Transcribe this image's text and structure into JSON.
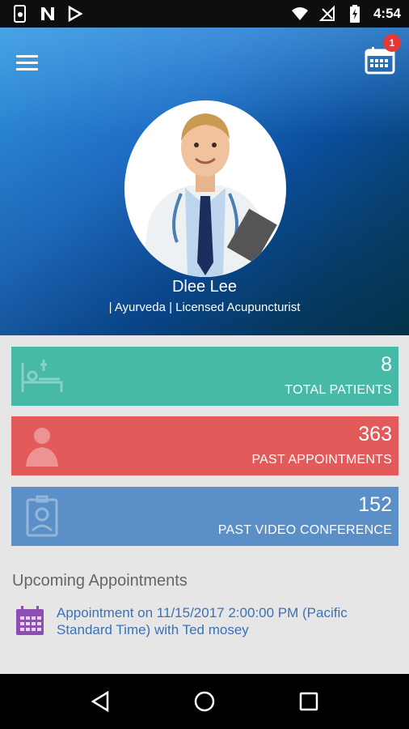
{
  "status_bar": {
    "time": "4:54",
    "left_icons": [
      "phone-settings-icon",
      "n-app-icon",
      "play-store-icon"
    ],
    "right_icons": [
      "wifi-icon",
      "no-signal-icon",
      "battery-charging-icon"
    ]
  },
  "header": {
    "menu_icon": "hamburger-icon",
    "calendar_icon": "calendar-icon",
    "notification_count": "1"
  },
  "profile": {
    "name": "Dlee Lee",
    "specialties": "| Ayurveda | Licensed Acupuncturist"
  },
  "stats": [
    {
      "value": "8",
      "label": "TOTAL PATIENTS",
      "icon": "patient-bed-icon",
      "color": "#47b9a7"
    },
    {
      "value": "363",
      "label": "PAST APPOINTMENTS",
      "icon": "doctor-icon",
      "color": "#e35a5a"
    },
    {
      "value": "152",
      "label": "PAST VIDEO CONFERENCE",
      "icon": "id-badge-icon",
      "color": "#5b8fc7"
    }
  ],
  "upcoming": {
    "title": "Upcoming Appointments",
    "items": [
      {
        "text": "Appointment on 11/15/2017 2:00:00 PM (Pacific Standard Time) with Ted mosey",
        "icon": "calendar-icon"
      }
    ]
  },
  "nav": {
    "buttons": [
      "back-icon",
      "home-icon",
      "recents-icon"
    ]
  },
  "colors": {
    "accent_blue": "#3a72b8",
    "appt_icon": "#8e4fb5"
  }
}
